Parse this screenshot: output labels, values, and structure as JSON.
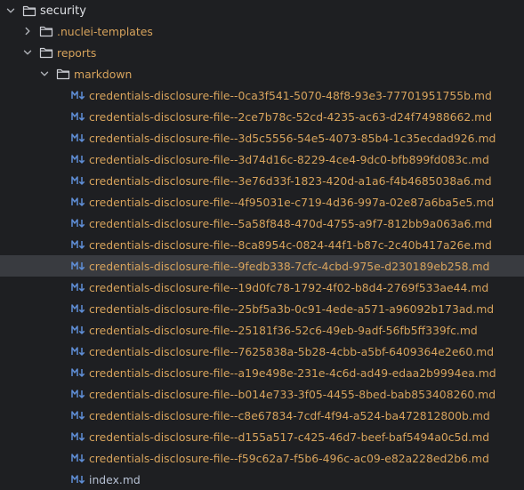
{
  "colors": {
    "background": "#1e1f22",
    "selection": "#393b40",
    "folder_text": "#dfe1e5",
    "untracked_file_text": "#d7a35c",
    "file_text": "#b6c0d3",
    "markdown_icon": "#5f8ed6"
  },
  "tree": {
    "folders": {
      "security": {
        "label": "security",
        "expanded": true,
        "icon": "folder-icon"
      },
      "nuclei_templates": {
        "label": ".nuclei-templates",
        "expanded": false,
        "icon": "folder-icon"
      },
      "reports": {
        "label": "reports",
        "expanded": true,
        "icon": "folder-icon"
      },
      "markdown": {
        "label": "markdown",
        "expanded": true,
        "icon": "folder-icon"
      }
    },
    "files": [
      {
        "name": "credentials-disclosure-file--0ca3f541-5070-48f8-93e3-77701951755b.md",
        "icon": "markdown-icon"
      },
      {
        "name": "credentials-disclosure-file--2ce7b78c-52cd-4235-ac63-d24f74988662.md",
        "icon": "markdown-icon"
      },
      {
        "name": "credentials-disclosure-file--3d5c5556-54e5-4073-85b4-1c35ecdad926.md",
        "icon": "markdown-icon"
      },
      {
        "name": "credentials-disclosure-file--3d74d16c-8229-4ce4-9dc0-bfb899fd083c.md",
        "icon": "markdown-icon"
      },
      {
        "name": "credentials-disclosure-file--3e76d33f-1823-420d-a1a6-f4b4685038a6.md",
        "icon": "markdown-icon"
      },
      {
        "name": "credentials-disclosure-file--4f95031e-c719-4d36-997a-02e87a6ba5e5.md",
        "icon": "markdown-icon"
      },
      {
        "name": "credentials-disclosure-file--5a58f848-470d-4755-a9f7-812bb9a063a6.md",
        "icon": "markdown-icon"
      },
      {
        "name": "credentials-disclosure-file--8ca8954c-0824-44f1-b87c-2c40b417a26e.md",
        "icon": "markdown-icon"
      },
      {
        "name": "credentials-disclosure-file--9fedb338-7cfc-4cbd-975e-d230189eb258.md",
        "icon": "markdown-icon",
        "selected": true
      },
      {
        "name": "credentials-disclosure-file--19d0fc78-1792-4f02-b8d4-2769f533ae44.md",
        "icon": "markdown-icon"
      },
      {
        "name": "credentials-disclosure-file--25bf5a3b-0c91-4ede-a571-a96092b173ad.md",
        "icon": "markdown-icon"
      },
      {
        "name": "credentials-disclosure-file--25181f36-52c6-49eb-9adf-56fb5ff339fc.md",
        "icon": "markdown-icon"
      },
      {
        "name": "credentials-disclosure-file--7625838a-5b28-4cbb-a5bf-6409364e2e60.md",
        "icon": "markdown-icon"
      },
      {
        "name": "credentials-disclosure-file--a19e498e-231e-4c6d-ad49-edaa2b9994ea.md",
        "icon": "markdown-icon"
      },
      {
        "name": "credentials-disclosure-file--b014e733-3f05-4455-8bed-bab853408260.md",
        "icon": "markdown-icon"
      },
      {
        "name": "credentials-disclosure-file--c8e67834-7cdf-4f94-a524-ba472812800b.md",
        "icon": "markdown-icon"
      },
      {
        "name": "credentials-disclosure-file--d155a517-c425-46d7-beef-baf5494a0c5d.md",
        "icon": "markdown-icon"
      },
      {
        "name": "credentials-disclosure-file--f59c62a7-f5b6-496c-ac09-e82a228ed2b6.md",
        "icon": "markdown-icon"
      },
      {
        "name": "index.md",
        "icon": "markdown-icon",
        "plain": true
      }
    ]
  }
}
